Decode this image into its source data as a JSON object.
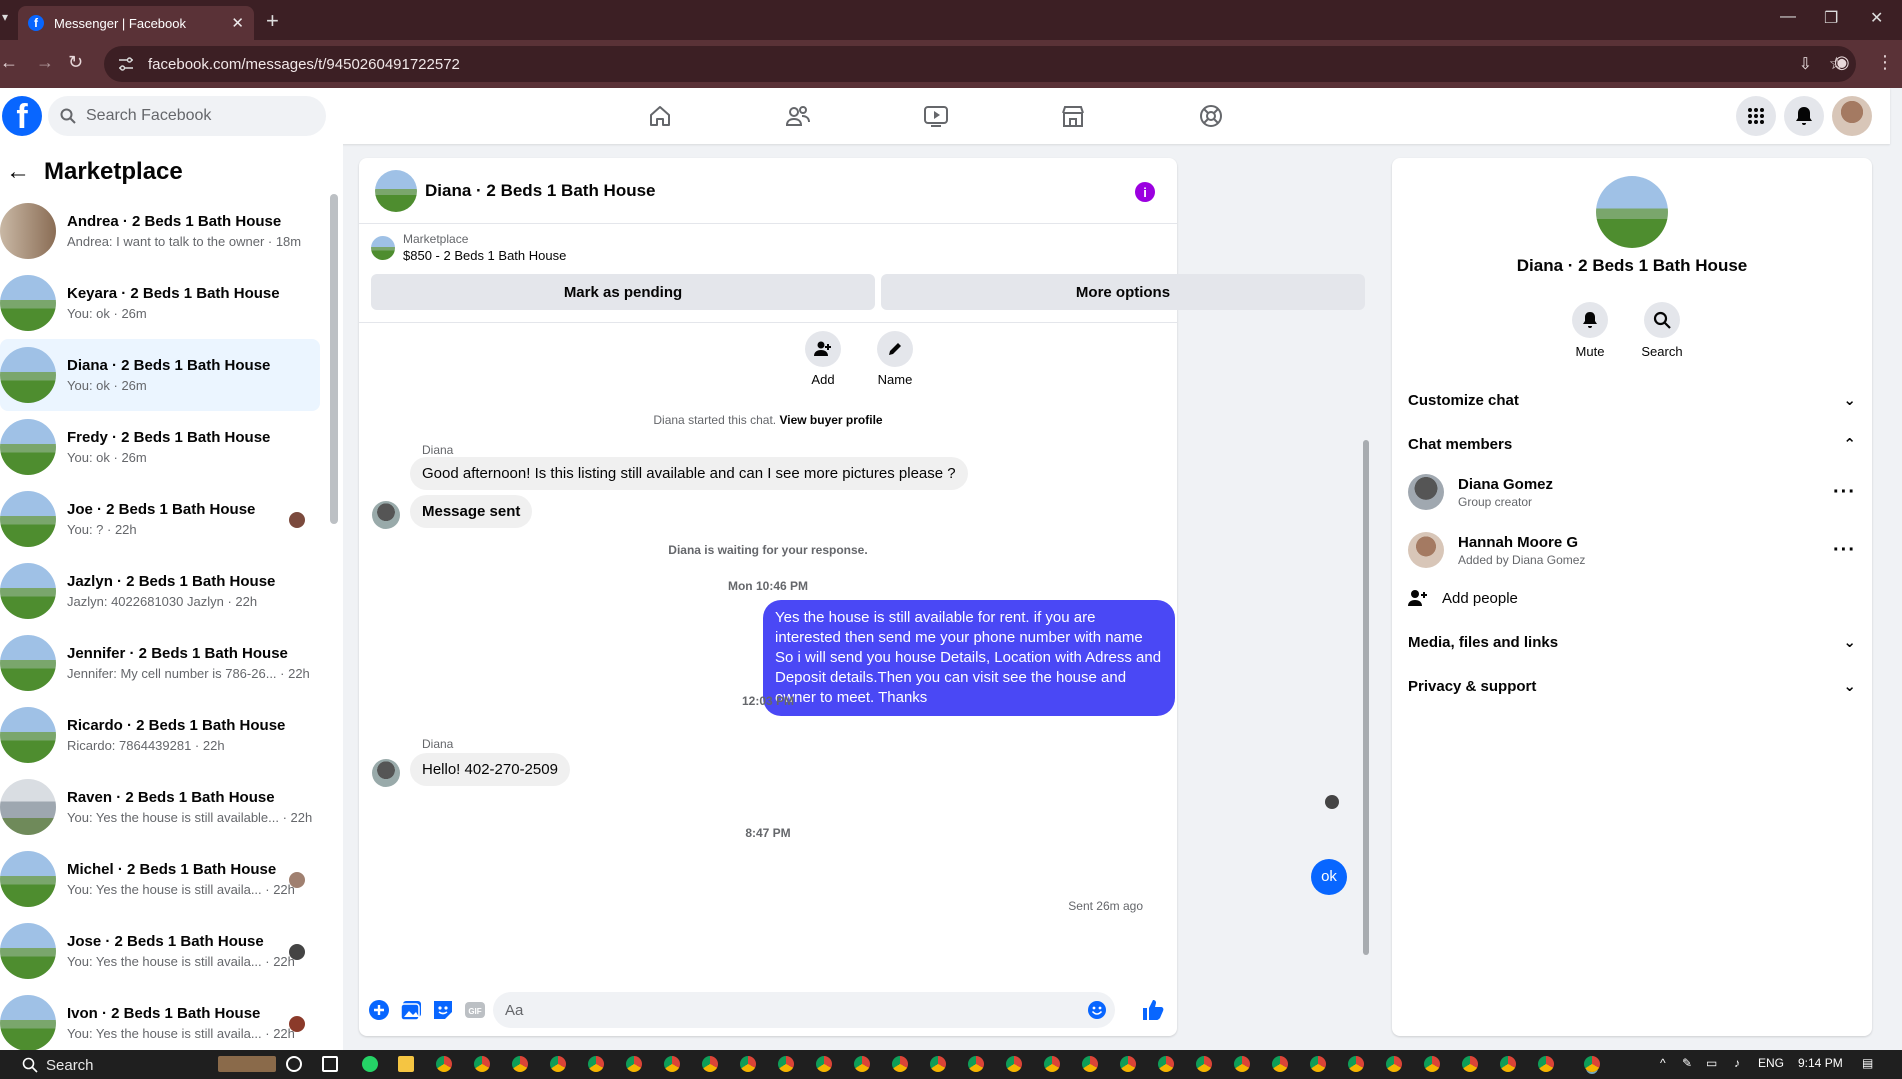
{
  "browser": {
    "tab_title": "Messenger | Facebook",
    "url": "facebook.com/messages/t/9450260491722572"
  },
  "fb": {
    "search_placeholder": "Search Facebook"
  },
  "left": {
    "title": "Marketplace",
    "conversations": [
      {
        "name": "Andrea · 2 Beds 1 Bath House",
        "preview": "Andrea: I want to talk to the owner · 18m"
      },
      {
        "name": "Keyara · 2 Beds 1 Bath House",
        "preview": "You: ok · 26m"
      },
      {
        "name": "Diana · 2 Beds 1 Bath House",
        "preview": "You: ok · 26m"
      },
      {
        "name": "Fredy · 2 Beds 1 Bath House",
        "preview": "You: ok · 26m"
      },
      {
        "name": "Joe · 2 Beds 1 Bath House",
        "preview": "You: ? · 22h"
      },
      {
        "name": "Jazlyn · 2 Beds 1 Bath House",
        "preview": "Jazlyn: 4022681030 Jazlyn · 22h"
      },
      {
        "name": "Jennifer · 2 Beds 1 Bath House",
        "preview": "Jennifer: My cell number is 786-26... · 22h"
      },
      {
        "name": "Ricardo · 2 Beds 1 Bath House",
        "preview": "Ricardo: 7864439281 · 22h"
      },
      {
        "name": "Raven · 2 Beds 1 Bath House",
        "preview": "You: Yes the house is still available... · 22h"
      },
      {
        "name": "Michel · 2 Beds 1 Bath House",
        "preview": "You: Yes the house is still availa... · 22h"
      },
      {
        "name": "Jose · 2 Beds 1 Bath House",
        "preview": "You: Yes the house is still availa... · 22h"
      },
      {
        "name": "Ivon · 2 Beds 1 Bath House",
        "preview": "You: Yes the house is still availa... · 22h"
      }
    ]
  },
  "chat": {
    "title": "Diana · 2 Beds 1 Bath House",
    "marketplace_label": "Marketplace",
    "listing": "$850 - 2 Beds 1 Bath House",
    "mark_pending": "Mark as pending",
    "more_options": "More options",
    "tool_add": "Add",
    "tool_name": "Name",
    "started_prefix": "Diana started this chat.",
    "view_profile": "View buyer profile",
    "sender1": "Diana",
    "msg1": "Good afternoon! Is this listing still available and can I see more pictures please ?",
    "msg2": "Message sent",
    "waiting": "Diana is waiting for your response.",
    "time1": "Mon 10:46 PM",
    "out1": "Yes the house is still available for rent. if you are interested then send me your phone number with name So i will send you house Details, Location with Adress and Deposit details.Then you can visit see the house and owner to meet. Thanks",
    "time2": "12:03 PM",
    "sender2": "Diana",
    "msg3": "Hello! 402-270-2509",
    "time3": "8:47 PM",
    "out2": "ok",
    "sent_status": "Sent 26m ago",
    "composer_placeholder": "Aa"
  },
  "right": {
    "title": "Diana · 2 Beds 1 Bath House",
    "mute": "Mute",
    "search": "Search",
    "customize": "Customize chat",
    "members_title": "Chat members",
    "members": [
      {
        "name": "Diana Gomez",
        "sub": "Group creator"
      },
      {
        "name": "Hannah Moore G",
        "sub": "Added by Diana Gomez"
      }
    ],
    "add_people": "Add people",
    "media": "Media, files and links",
    "privacy": "Privacy & support"
  },
  "taskbar": {
    "search": "Search",
    "lang": "ENG",
    "time": "9:14 PM"
  },
  "colors": {
    "fb_blue": "#0866ff",
    "outgoing_bubble": "#4a48f5",
    "info_purple": "#9b00e0",
    "chrome_dark": "#3c1f24"
  }
}
